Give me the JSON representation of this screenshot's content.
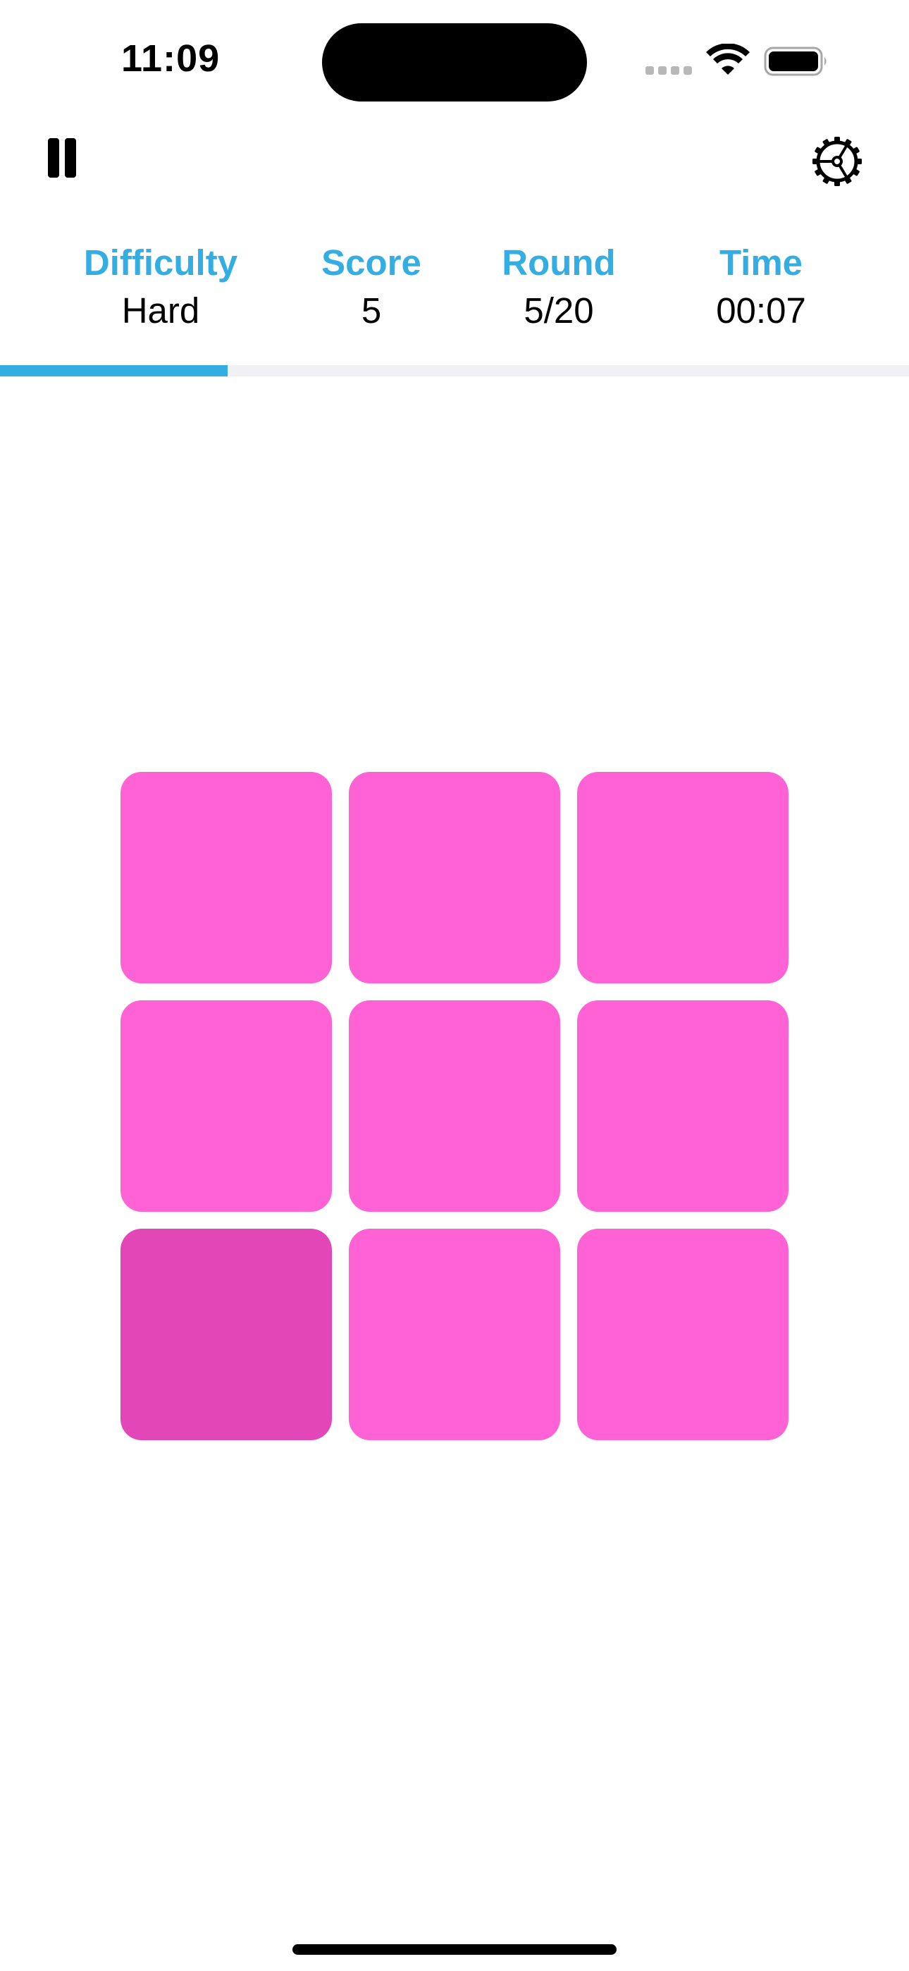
{
  "status_bar": {
    "time": "11:09"
  },
  "controls": {
    "pause_icon": "pause-icon",
    "settings_icon": "gear-icon"
  },
  "stats": {
    "difficulty_label": "Difficulty",
    "difficulty_value": "Hard",
    "score_label": "Score",
    "score_value": "5",
    "round_label": "Round",
    "round_value": "5/20",
    "time_label": "Time",
    "time_value": "00:07"
  },
  "progress": {
    "fraction": 0.25,
    "color": "#34aee2",
    "track_color": "#f1f1f4"
  },
  "grid": {
    "rows": 3,
    "columns": 3,
    "base_color": "#ff62d4",
    "odd_color": "#e347b7",
    "odd_tile_index": 6
  }
}
